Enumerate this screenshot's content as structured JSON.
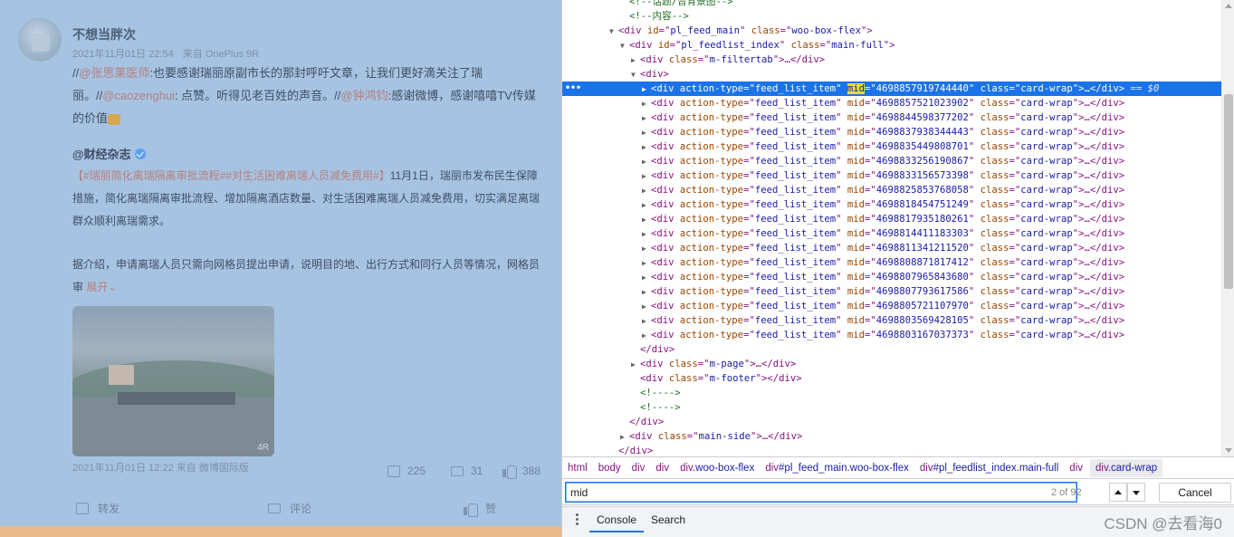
{
  "left_page": {
    "user_name": "不想当胖次",
    "post_time": "2021年11月01日 22:54",
    "post_source": "来自 OnePlus 9R",
    "post_text": [
      {
        "t": "//",
        "c": "text"
      },
      {
        "t": "@张思莱医师",
        "c": "link"
      },
      {
        "t": ":也要感谢瑞丽原副市长的那封呼吁文章，让我们更好滴关注了瑞丽。//",
        "c": "text"
      },
      {
        "t": "@caozenghui",
        "c": "link"
      },
      {
        "t": ": 点赞。听得见老百姓的声音。//",
        "c": "text"
      },
      {
        "t": "@钟鸿钧",
        "c": "link"
      },
      {
        "t": ":感谢微博，感谢嘻嘻TV传媒的价值",
        "c": "text"
      }
    ],
    "repost_author": "@财经杂志",
    "repost_tags": "【#瑞丽简化离瑞隔离审批流程##对生活困难离瑞人员减免费用#】",
    "repost_text1": "11月1日，瑞丽市发布民生保障措施，简化离瑞隔离审批流程、增加隔离酒店数量、对生活困难离瑞人员减免费用，切实满足离瑞群众顺利离瑞需求。",
    "repost_text2": "据介绍，申请离瑞人员只需向网格员提出申请，说明目的地、出行方式和同行人员等情况，网格员审",
    "expand_label": "展开",
    "photo_watermark": "4R",
    "repost_time": "2021年11月01日 12:22",
    "repost_source": "来自 微博国际版",
    "repost_stats": {
      "share": "225",
      "comment": "31",
      "like": "388"
    },
    "actions": {
      "share": "转发",
      "comment": "评论",
      "like": "赞"
    }
  },
  "devtools": {
    "dom_lines": [
      {
        "indent": 6,
        "arrow": "",
        "kind": "comment",
        "text": "<!--话题/音背景图-->",
        "cut": true
      },
      {
        "indent": 6,
        "arrow": "",
        "kind": "comment",
        "text": "<!--内容-->"
      },
      {
        "indent": 5,
        "arrow": "▼",
        "kind": "tag",
        "tag": "div",
        "attrs": [
          [
            "id",
            "pl_feed_main"
          ],
          [
            "class",
            "woo-box-flex"
          ]
        ],
        "close": ">"
      },
      {
        "indent": 6,
        "arrow": "▼",
        "kind": "tag",
        "tag": "div",
        "attrs": [
          [
            "id",
            "pl_feedlist_index"
          ],
          [
            "class",
            "main-full"
          ]
        ],
        "close": ">"
      },
      {
        "indent": 7,
        "arrow": "▶",
        "kind": "tag",
        "tag": "div",
        "attrs": [
          [
            "class",
            "m-filtertab"
          ]
        ],
        "close": ">…</div>"
      },
      {
        "indent": 7,
        "arrow": "▼",
        "kind": "tag",
        "tag": "div",
        "attrs": [],
        "close": ">"
      },
      {
        "indent": 8,
        "arrow": "▶",
        "kind": "item",
        "mid": "4698857919744440",
        "selected": true
      },
      {
        "indent": 8,
        "arrow": "▶",
        "kind": "item",
        "mid": "4698857521023902"
      },
      {
        "indent": 8,
        "arrow": "▶",
        "kind": "item",
        "mid": "4698844598377202"
      },
      {
        "indent": 8,
        "arrow": "▶",
        "kind": "item",
        "mid": "4698837938344443"
      },
      {
        "indent": 8,
        "arrow": "▶",
        "kind": "item",
        "mid": "4698835449808701"
      },
      {
        "indent": 8,
        "arrow": "▶",
        "kind": "item",
        "mid": "4698833256190867"
      },
      {
        "indent": 8,
        "arrow": "▶",
        "kind": "item",
        "mid": "4698833156573398"
      },
      {
        "indent": 8,
        "arrow": "▶",
        "kind": "item",
        "mid": "4698825853768058"
      },
      {
        "indent": 8,
        "arrow": "▶",
        "kind": "item",
        "mid": "4698818454751249"
      },
      {
        "indent": 8,
        "arrow": "▶",
        "kind": "item",
        "mid": "4698817935180261"
      },
      {
        "indent": 8,
        "arrow": "▶",
        "kind": "item",
        "mid": "4698814411183303"
      },
      {
        "indent": 8,
        "arrow": "▶",
        "kind": "item",
        "mid": "4698811341211520"
      },
      {
        "indent": 8,
        "arrow": "▶",
        "kind": "item",
        "mid": "4698808871817412"
      },
      {
        "indent": 8,
        "arrow": "▶",
        "kind": "item",
        "mid": "4698807965843680"
      },
      {
        "indent": 8,
        "arrow": "▶",
        "kind": "item",
        "mid": "4698807793617586"
      },
      {
        "indent": 8,
        "arrow": "▶",
        "kind": "item",
        "mid": "4698805721107970"
      },
      {
        "indent": 8,
        "arrow": "▶",
        "kind": "item",
        "mid": "4698803569428105"
      },
      {
        "indent": 8,
        "arrow": "▶",
        "kind": "item",
        "mid": "4698803167037373"
      },
      {
        "indent": 7,
        "arrow": "",
        "kind": "raw",
        "text": "</div>"
      },
      {
        "indent": 7,
        "arrow": "▶",
        "kind": "tag",
        "tag": "div",
        "attrs": [
          [
            "class",
            "m-page"
          ]
        ],
        "close": ">…</div>"
      },
      {
        "indent": 7,
        "arrow": "",
        "kind": "tag",
        "tag": "div",
        "attrs": [
          [
            "class",
            "m-footer"
          ]
        ],
        "close": "></div>"
      },
      {
        "indent": 7,
        "arrow": "",
        "kind": "comment",
        "text": "<!---->"
      },
      {
        "indent": 7,
        "arrow": "",
        "kind": "comment",
        "text": "<!---->"
      },
      {
        "indent": 6,
        "arrow": "",
        "kind": "raw",
        "text": "</div>"
      },
      {
        "indent": 6,
        "arrow": "▶",
        "kind": "tag",
        "tag": "div",
        "attrs": [
          [
            "class",
            "main-side"
          ]
        ],
        "close": ">…</div>"
      },
      {
        "indent": 5,
        "arrow": "",
        "kind": "raw",
        "text": "</div>"
      }
    ],
    "item_attr_action": "feed_list_item",
    "item_attr_class": "card-wrap",
    "selected_suffix": "== $0",
    "breadcrumbs": [
      {
        "tag": "html",
        "rest": ""
      },
      {
        "tag": "body",
        "rest": ""
      },
      {
        "tag": "div",
        "rest": ""
      },
      {
        "tag": "div",
        "rest": ""
      },
      {
        "tag": "div",
        "rest": ".woo-box-flex"
      },
      {
        "tag": "div",
        "rest": "#pl_feed_main.woo-box-flex"
      },
      {
        "tag": "div",
        "rest": "#pl_feedlist_index.main-full"
      },
      {
        "tag": "div",
        "rest": ""
      },
      {
        "tag": "div",
        "rest": ".card-wrap",
        "active": true
      }
    ],
    "search": {
      "value": "mid",
      "count": "2 of 92",
      "cancel_label": "Cancel"
    },
    "drawer_tabs": {
      "console": "Console",
      "search": "Search"
    },
    "watermark": "CSDN @去看海0"
  }
}
